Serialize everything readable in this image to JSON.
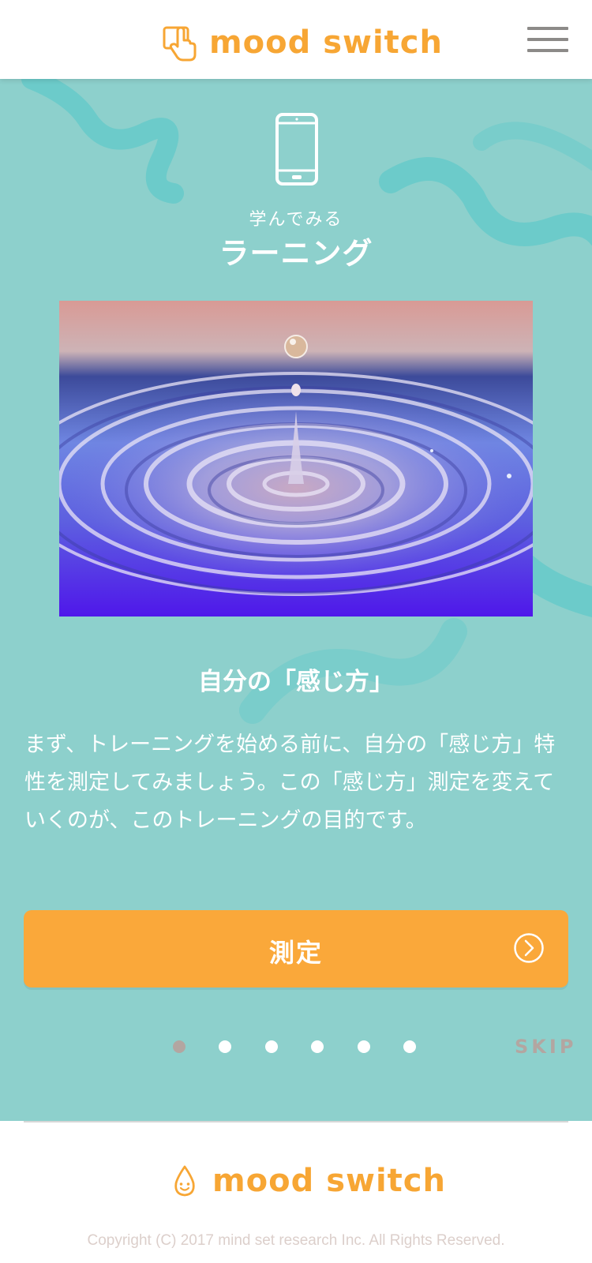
{
  "header": {
    "logo_text": "mood switch",
    "logo_icon": "hand-pointer-icon",
    "menu_icon": "hamburger-menu-icon"
  },
  "slide": {
    "icon": "smartphone-icon",
    "subtitle": "学んでみる",
    "title": "ラーニング",
    "image": "water-drop-ripple-photo",
    "heading": "自分の「感じ方」",
    "body": "まず、トレーニングを始める前に、自分の「感じ方」特性を測定してみましょう。この「感じ方」測定を変えていくのが、このトレーニングの目的です。",
    "button_label": "測定",
    "button_icon": "chevron-right-circle-icon"
  },
  "pager": {
    "total": 6,
    "active_index": 0,
    "skip_label": "SKIP"
  },
  "footer": {
    "logo_text": "mood switch",
    "logo_icon": "smiling-drop-icon",
    "copyright": "Copyright (C) 2017 mind set research Inc. All Rights Reserved."
  },
  "colors": {
    "accent_orange": "#faa83a",
    "teal_background": "#8dd0cc",
    "teal_stripe": "#6ccbca",
    "inactive_gray": "#b3a6a1"
  }
}
